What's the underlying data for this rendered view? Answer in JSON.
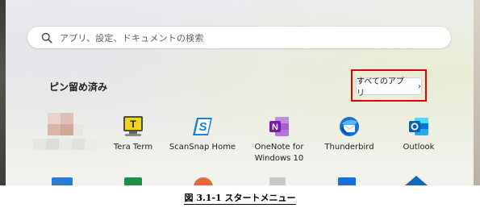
{
  "search": {
    "placeholder": "アプリ、設定、ドキュメントの検索",
    "icon": "search-icon"
  },
  "pinned": {
    "title": "ピン留め済み",
    "all_apps_label": "すべてのアプリ",
    "all_apps_chevron": "›",
    "highlight_color": "#e00000"
  },
  "apps": [
    {
      "label": "Tera Term",
      "icon": "tera-term-icon"
    },
    {
      "label": "ScanSnap Home",
      "icon": "scansnap-icon"
    },
    {
      "label": "OneNote for",
      "label2": "Windows 10",
      "icon": "onenote-icon"
    },
    {
      "label": "Thunderbird",
      "icon": "thunderbird-icon"
    },
    {
      "label": "Outlook",
      "icon": "outlook-icon"
    }
  ],
  "caption": {
    "text": "図 3.1-1 スタートメニュー"
  }
}
